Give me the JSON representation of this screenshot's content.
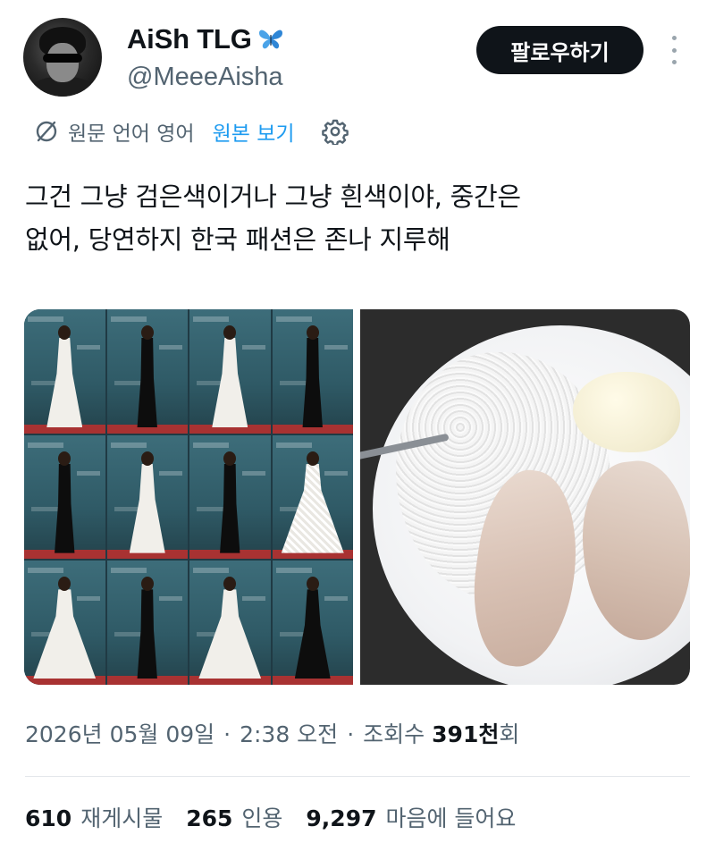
{
  "author": {
    "display_name": "AiSh TLG",
    "display_name_emoji_icon": "butterfly-icon",
    "handle": "@MeeeAisha"
  },
  "follow_button": {
    "label": "팔로우하기"
  },
  "more_menu": {
    "icon": "more-vertical-icon"
  },
  "translation_bar": {
    "icon": "globe-off-icon",
    "text": "원문 언어 영어",
    "show_original": "원본 보기",
    "settings_icon": "gear-icon"
  },
  "tweet": {
    "text_line1": "그건 그냥 검은색이거나 그냥 흰색이야, 중간은",
    "text_line2": "없어, 당연하지 한국 패션은 존나 지루해"
  },
  "media": {
    "left_image": "red-carpet-collage",
    "right_image": "rice-and-chicken-plate"
  },
  "meta": {
    "date": "2026년 05월 09일",
    "time": "2:38 오전",
    "views_label": "조회수",
    "views_count": "391천",
    "views_suffix": "회",
    "separator": "·"
  },
  "stats": {
    "reposts": {
      "count": "610",
      "label": "재게시물"
    },
    "quotes": {
      "count": "265",
      "label": "인용"
    },
    "likes": {
      "count": "9,297",
      "label": "마음에 들어요"
    }
  },
  "colors": {
    "link_blue": "#1d9bf0",
    "muted_text": "#536471",
    "primary_text": "#0f1419",
    "follow_button_bg": "#0f1419"
  }
}
